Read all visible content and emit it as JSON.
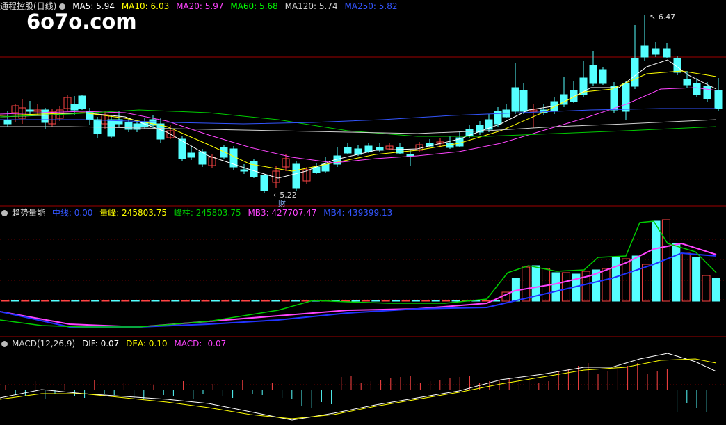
{
  "header": {
    "title": "通程控股(日线)",
    "ma": [
      {
        "label": "MA5: 5.94",
        "color": "#ffffff"
      },
      {
        "label": "MA10: 6.03",
        "color": "#ffff00"
      },
      {
        "label": "MA20: 5.97",
        "color": "#ff44ff"
      },
      {
        "label": "MA60: 5.68",
        "color": "#00ff00"
      },
      {
        "label": "MA120: 5.74",
        "color": "#d0d0d0"
      },
      {
        "label": "MA250: 5.82",
        "color": "#3333ff"
      }
    ]
  },
  "watermark": "6o7o.com",
  "price_panel": {
    "high_label": "6.47",
    "low_label": "5.22",
    "event_label": "财"
  },
  "volume_panel": {
    "title": "趋势量能",
    "items": [
      {
        "label": "中线: 0.00",
        "color": "#3333ff"
      },
      {
        "label": "量峰: 245803.75",
        "color": "#ffff00"
      },
      {
        "label": "峰柱: 245803.75",
        "color": "#00cc00"
      },
      {
        "label": "MB3: 427707.47",
        "color": "#ff44ff"
      },
      {
        "label": "MB4: 439399.13",
        "color": "#3333ff"
      }
    ]
  },
  "macd_panel": {
    "title": "MACD(12,26,9)",
    "items": [
      {
        "label": "DIF: 0.07",
        "color": "#ffffff"
      },
      {
        "label": "DEA: 0.10",
        "color": "#ffff00"
      },
      {
        "label": "MACD: -0.07",
        "color": "#ff44ff"
      }
    ]
  }
}
